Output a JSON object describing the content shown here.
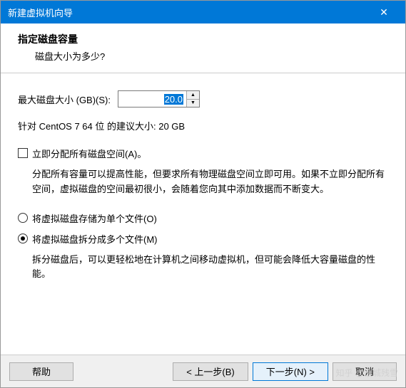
{
  "titlebar": {
    "title": "新建虚拟机向导"
  },
  "header": {
    "title": "指定磁盘容量",
    "sub": "磁盘大小为多少?"
  },
  "size": {
    "label": "最大磁盘大小 (GB)(S):",
    "value": "20.0"
  },
  "recommend": "针对 CentOS 7 64 位 的建议大小: 20 GB",
  "allocate": {
    "label": "立即分配所有磁盘空间(A)。",
    "desc": "分配所有容量可以提高性能，但要求所有物理磁盘空间立即可用。如果不立即分配所有空间，虚拟磁盘的空间最初很小，会随着您向其中添加数据而不断变大。"
  },
  "radio": {
    "single": "将虚拟磁盘存储为单个文件(O)",
    "split": "将虚拟磁盘拆分成多个文件(M)",
    "splitDesc": "拆分磁盘后，可以更轻松地在计算机之间移动虚拟机，但可能会降低大容量磁盘的性能。"
  },
  "buttons": {
    "help": "帮助",
    "back": "< 上一步(B)",
    "next": "下一步(N) >",
    "cancel": "取消"
  },
  "watermark": "知乎 @饿城残雪"
}
